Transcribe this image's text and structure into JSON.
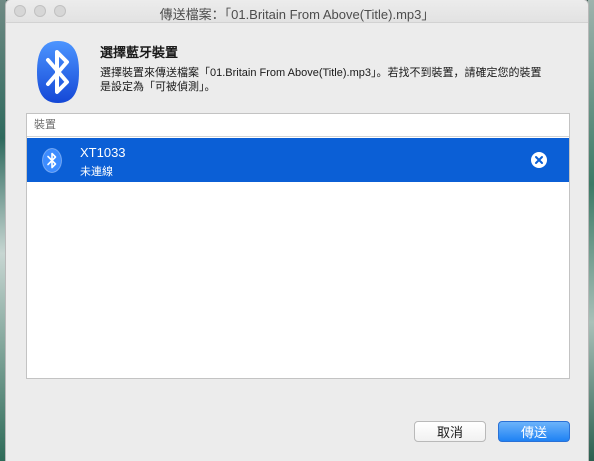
{
  "window": {
    "title": "傳送檔案：「01.Britain From Above(Title).mp3」"
  },
  "header": {
    "title": "選擇藍牙裝置",
    "desc_line1": "選擇裝置來傳送檔案「01.Britain From Above(Title).mp3」。若找不到裝置，請確定您的裝置",
    "desc_line2": "是設定為「可被偵測」。",
    "logo_icon": "bluetooth-icon"
  },
  "device_list": {
    "column_header": "裝置",
    "items": [
      {
        "name": "XT1033",
        "status": "未連線",
        "icon": "bluetooth-icon",
        "action_icon": "remove-circle-icon",
        "selected": true
      }
    ]
  },
  "buttons": {
    "cancel_label": "取消",
    "send_label": "傳送"
  },
  "colors": {
    "selection": "#0b5fd6",
    "primary_button": "#1f82f4",
    "bluetooth_blue": "#1f6ff0"
  }
}
